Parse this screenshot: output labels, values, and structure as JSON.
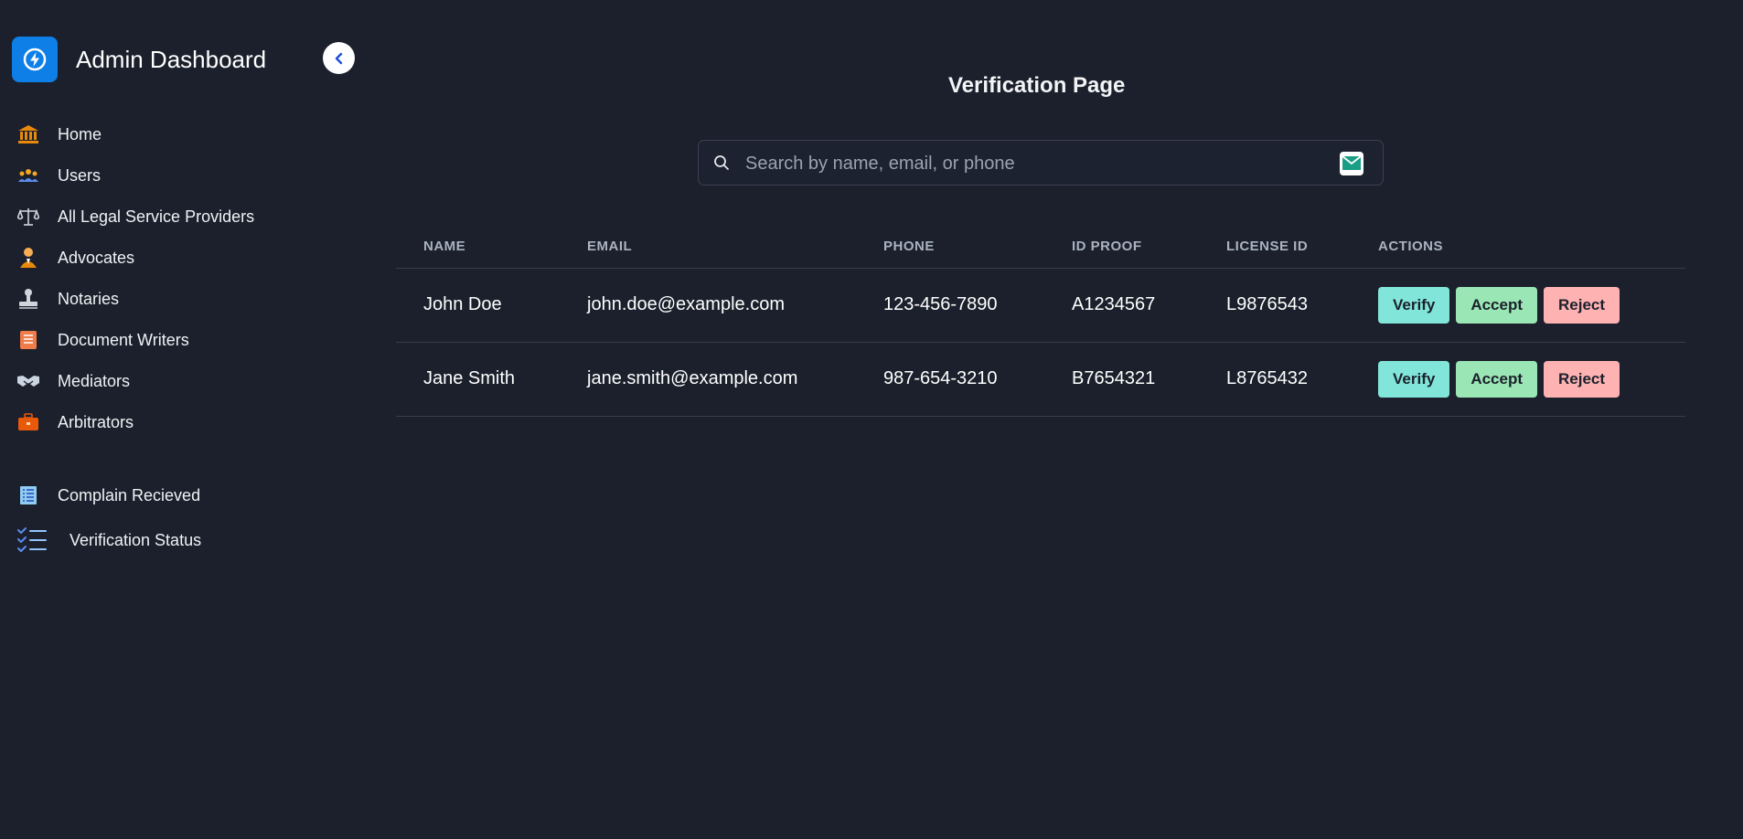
{
  "sidebar": {
    "brand_title": "Admin Dashboard",
    "items": [
      {
        "label": "Home",
        "icon": "bank-icon"
      },
      {
        "label": "Users",
        "icon": "users-icon"
      },
      {
        "label": "All Legal Service Providers",
        "icon": "scales-icon"
      },
      {
        "label": "Advocates",
        "icon": "advocate-icon"
      },
      {
        "label": "Notaries",
        "icon": "stamp-icon"
      },
      {
        "label": "Document Writers",
        "icon": "document-icon"
      },
      {
        "label": "Mediators",
        "icon": "handshake-icon"
      },
      {
        "label": "Arbitrators",
        "icon": "briefcase-icon"
      },
      {
        "label": "Complain Recieved",
        "icon": "list-icon"
      },
      {
        "label": "Verification Status",
        "icon": "checklist-icon"
      }
    ]
  },
  "main": {
    "title": "Verification Page",
    "search": {
      "placeholder": "Search by name, email, or phone",
      "value": ""
    },
    "table": {
      "headers": [
        "NAME",
        "EMAIL",
        "PHONE",
        "ID PROOF",
        "LICENSE ID",
        "ACTIONS"
      ],
      "rows": [
        {
          "name": "John Doe",
          "email": "john.doe@example.com",
          "phone": "123-456-7890",
          "id_proof": "A1234567",
          "license_id": "L9876543"
        },
        {
          "name": "Jane Smith",
          "email": "jane.smith@example.com",
          "phone": "987-654-3210",
          "id_proof": "B7654321",
          "license_id": "L8765432"
        }
      ],
      "actions": {
        "verify": "Verify",
        "accept": "Accept",
        "reject": "Reject"
      }
    }
  },
  "colors": {
    "background": "#1b202c",
    "brand": "#0d7fe6",
    "verify": "#81e6d9",
    "accept": "#9ae6b4",
    "reject": "#feb2b2"
  }
}
